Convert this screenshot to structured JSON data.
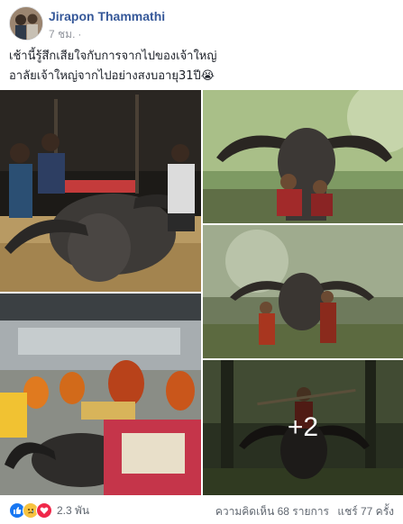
{
  "post": {
    "author": "Jirapon Thammathi",
    "time": "7 ชม.",
    "privacy_icon": "globe-icon",
    "lines": [
      "เช้านี้รู้สึกเสียใจกับการจากไปของเจ้าใหญ่",
      "อาลัยเจ้าใหญ่จากไปอย่างสงบอายุ31ปี😭"
    ]
  },
  "gallery": {
    "more_count": "+2"
  },
  "footer": {
    "reaction_icons": [
      "like-icon",
      "sad-icon",
      "love-icon"
    ],
    "reaction_count": "2.3 พัน",
    "comments": "ความคิดเห็น 68 รายการ",
    "shares": "แชร์ 77 ครั้ง"
  },
  "colors": {
    "author_link": "#365899",
    "meta_text": "#90949c",
    "like_blue": "#1877f2",
    "love_red": "#f0284a",
    "sad_yellow": "#f7c341"
  }
}
